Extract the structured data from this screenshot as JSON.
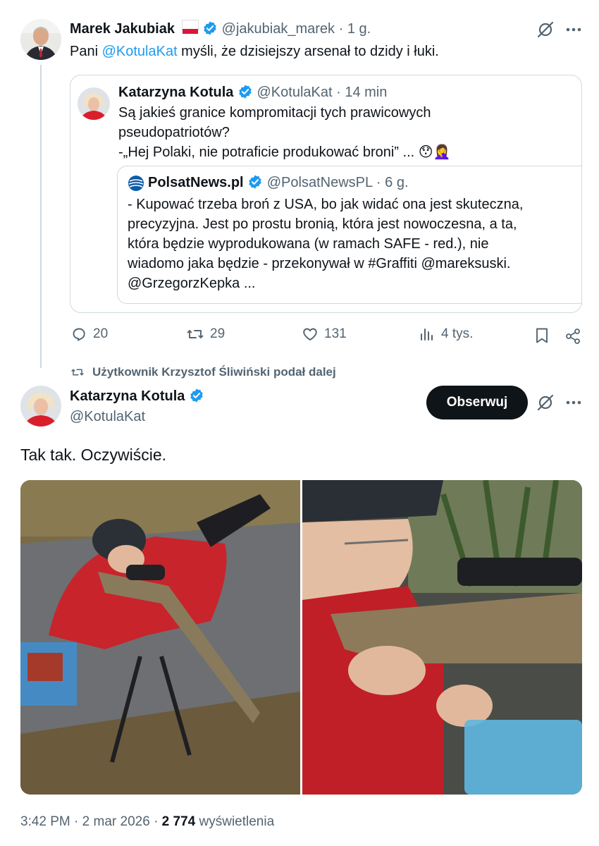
{
  "tweet1": {
    "author_name": "Marek Jakubiak",
    "flag": "🇵🇱",
    "handle": "@jakubiak_marek",
    "separator": "·",
    "time": "1 g.",
    "text_prefix": "Pani ",
    "mention": "@KotulaKat",
    "text_suffix": " myśli, że dzisiejszy arsenał to dzidy i łuki.",
    "quote": {
      "author_name": "Katarzyna Kotula",
      "handle": "@KotulaKat",
      "time": "14 min",
      "line1": "Są jakieś granice kompromitacji tych prawicowych",
      "line2": "pseudopatriotów?",
      "line3": "-„Hej Polaki, nie potraficie produkować broni” ...",
      "emojis": "😯🤦‍♀️",
      "nested": {
        "author_name": "PolsatNews.pl",
        "handle": "@PolsatNewsPL",
        "time": "6 g.",
        "line1": "- Kupować trzeba broń z USA, bo jak widać ona jest skuteczna,",
        "line2": "precyzyjna. Jest po prostu bronią, która jest nowoczesna, a ta,",
        "line3": "która będzie wyprodukowana (w ramach SAFE - red.), nie",
        "line4": "wiadomo jaka będzie - przekonywał w #Graffiti @mareksuski.",
        "line5": "@GrzegorzKepka ..."
      }
    },
    "actions": {
      "replies": "20",
      "reposts": "29",
      "likes": "131",
      "views": "4 tys."
    }
  },
  "repost_banner": "Użytkownik Krzysztof Śliwiński podał dalej",
  "tweet2": {
    "author_name": "Katarzyna Kotula",
    "handle": "@KotulaKat",
    "follow_label": "Obserwuj",
    "text": "Tak tak. Oczywiście.",
    "time": "3:42 PM",
    "date": "2 mar 2026",
    "views_count": "2 774",
    "views_label": "wyświetlenia"
  },
  "colors": {
    "accent": "#1d9bf0",
    "text": "#0f1419",
    "secondary": "#536471",
    "border": "#cfd9de"
  }
}
